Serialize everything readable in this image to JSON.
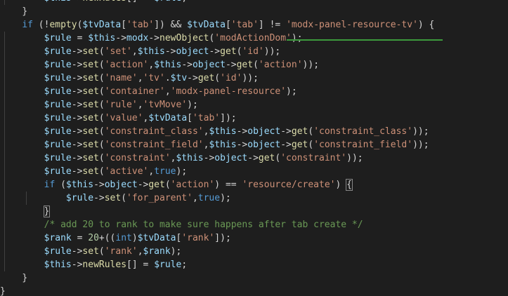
{
  "editor": {
    "theme_colors": {
      "background": "#1e1e1e",
      "keyword": "#569cd6",
      "variable": "#9cdcfe",
      "function": "#dcdcaa",
      "string": "#ce9178",
      "comment": "#6a9955",
      "number": "#b5cea8",
      "plain": "#d4d4d4",
      "squiggle": "#3c9a3c"
    },
    "lines": [
      {
        "indent": 8,
        "tokens": [
          [
            "var",
            "$this"
          ],
          [
            "op",
            "->"
          ],
          [
            "fn",
            "newRules"
          ],
          [
            "op",
            "[] = "
          ],
          [
            "var",
            "$rule"
          ],
          [
            "op",
            ";"
          ]
        ]
      },
      {
        "indent": 4,
        "tokens": [
          [
            "op",
            "}"
          ]
        ]
      },
      {
        "indent": 4,
        "tokens": [
          [
            "kw",
            "if"
          ],
          [
            "op",
            " (!"
          ],
          [
            "fn",
            "empty"
          ],
          [
            "op",
            "("
          ],
          [
            "var",
            "$tvData"
          ],
          [
            "op",
            "["
          ],
          [
            "str",
            "'tab'"
          ],
          [
            "op",
            "]) && "
          ],
          [
            "var",
            "$tvData"
          ],
          [
            "op",
            "["
          ],
          [
            "str",
            "'tab'"
          ],
          [
            "op",
            "] != "
          ],
          [
            "str",
            "'modx-panel-resource-tv'"
          ],
          [
            "op",
            ") {"
          ]
        ]
      },
      {
        "indent": 8,
        "tokens": [
          [
            "var",
            "$rule"
          ],
          [
            "op",
            " = "
          ],
          [
            "var",
            "$this"
          ],
          [
            "op",
            "->"
          ],
          [
            "var",
            "modx"
          ],
          [
            "op",
            "->"
          ],
          [
            "fn",
            "newObject"
          ],
          [
            "op",
            "("
          ],
          [
            "str",
            "'modActionDom'"
          ],
          [
            "op",
            ");"
          ]
        ]
      },
      {
        "indent": 8,
        "tokens": [
          [
            "var",
            "$rule"
          ],
          [
            "op",
            "->"
          ],
          [
            "fn",
            "set"
          ],
          [
            "op",
            "("
          ],
          [
            "str",
            "'set'"
          ],
          [
            "op",
            ","
          ],
          [
            "var",
            "$this"
          ],
          [
            "op",
            "->"
          ],
          [
            "var",
            "object"
          ],
          [
            "op",
            "->"
          ],
          [
            "fn",
            "get"
          ],
          [
            "op",
            "("
          ],
          [
            "str",
            "'id'"
          ],
          [
            "op",
            "));"
          ]
        ]
      },
      {
        "indent": 8,
        "tokens": [
          [
            "var",
            "$rule"
          ],
          [
            "op",
            "->"
          ],
          [
            "fn",
            "set"
          ],
          [
            "op",
            "("
          ],
          [
            "str",
            "'action'"
          ],
          [
            "op",
            ","
          ],
          [
            "var",
            "$this"
          ],
          [
            "op",
            "->"
          ],
          [
            "var",
            "object"
          ],
          [
            "op",
            "->"
          ],
          [
            "fn",
            "get"
          ],
          [
            "op",
            "("
          ],
          [
            "str",
            "'action'"
          ],
          [
            "op",
            "));"
          ]
        ]
      },
      {
        "indent": 8,
        "tokens": [
          [
            "var",
            "$rule"
          ],
          [
            "op",
            "->"
          ],
          [
            "fn",
            "set"
          ],
          [
            "op",
            "("
          ],
          [
            "str",
            "'name'"
          ],
          [
            "op",
            ","
          ],
          [
            "str",
            "'tv'"
          ],
          [
            "op",
            "."
          ],
          [
            "var",
            "$tv"
          ],
          [
            "op",
            "->"
          ],
          [
            "fn",
            "get"
          ],
          [
            "op",
            "("
          ],
          [
            "str",
            "'id'"
          ],
          [
            "op",
            "));"
          ]
        ]
      },
      {
        "indent": 8,
        "tokens": [
          [
            "var",
            "$rule"
          ],
          [
            "op",
            "->"
          ],
          [
            "fn",
            "set"
          ],
          [
            "op",
            "("
          ],
          [
            "str",
            "'container'"
          ],
          [
            "op",
            ","
          ],
          [
            "str",
            "'modx-panel-resource'"
          ],
          [
            "op",
            ");"
          ]
        ]
      },
      {
        "indent": 8,
        "tokens": [
          [
            "var",
            "$rule"
          ],
          [
            "op",
            "->"
          ],
          [
            "fn",
            "set"
          ],
          [
            "op",
            "("
          ],
          [
            "str",
            "'rule'"
          ],
          [
            "op",
            ","
          ],
          [
            "str",
            "'tvMove'"
          ],
          [
            "op",
            ");"
          ]
        ]
      },
      {
        "indent": 8,
        "tokens": [
          [
            "var",
            "$rule"
          ],
          [
            "op",
            "->"
          ],
          [
            "fn",
            "set"
          ],
          [
            "op",
            "("
          ],
          [
            "str",
            "'value'"
          ],
          [
            "op",
            ","
          ],
          [
            "var",
            "$tvData"
          ],
          [
            "op",
            "["
          ],
          [
            "str",
            "'tab'"
          ],
          [
            "op",
            "]);"
          ]
        ]
      },
      {
        "indent": 8,
        "tokens": [
          [
            "var",
            "$rule"
          ],
          [
            "op",
            "->"
          ],
          [
            "fn",
            "set"
          ],
          [
            "op",
            "("
          ],
          [
            "str",
            "'constraint_class'"
          ],
          [
            "op",
            ","
          ],
          [
            "var",
            "$this"
          ],
          [
            "op",
            "->"
          ],
          [
            "var",
            "object"
          ],
          [
            "op",
            "->"
          ],
          [
            "fn",
            "get"
          ],
          [
            "op",
            "("
          ],
          [
            "str",
            "'constraint_class'"
          ],
          [
            "op",
            "));"
          ]
        ]
      },
      {
        "indent": 8,
        "tokens": [
          [
            "var",
            "$rule"
          ],
          [
            "op",
            "->"
          ],
          [
            "fn",
            "set"
          ],
          [
            "op",
            "("
          ],
          [
            "str",
            "'constraint_field'"
          ],
          [
            "op",
            ","
          ],
          [
            "var",
            "$this"
          ],
          [
            "op",
            "->"
          ],
          [
            "var",
            "object"
          ],
          [
            "op",
            "->"
          ],
          [
            "fn",
            "get"
          ],
          [
            "op",
            "("
          ],
          [
            "str",
            "'constraint_field'"
          ],
          [
            "op",
            "));"
          ]
        ]
      },
      {
        "indent": 8,
        "tokens": [
          [
            "var",
            "$rule"
          ],
          [
            "op",
            "->"
          ],
          [
            "fn",
            "set"
          ],
          [
            "op",
            "("
          ],
          [
            "str",
            "'constraint'"
          ],
          [
            "op",
            ","
          ],
          [
            "var",
            "$this"
          ],
          [
            "op",
            "->"
          ],
          [
            "var",
            "object"
          ],
          [
            "op",
            "->"
          ],
          [
            "fn",
            "get"
          ],
          [
            "op",
            "("
          ],
          [
            "str",
            "'constraint'"
          ],
          [
            "op",
            "));"
          ]
        ]
      },
      {
        "indent": 8,
        "tokens": [
          [
            "var",
            "$rule"
          ],
          [
            "op",
            "->"
          ],
          [
            "fn",
            "set"
          ],
          [
            "op",
            "("
          ],
          [
            "str",
            "'active'"
          ],
          [
            "op",
            ","
          ],
          [
            "kw",
            "true"
          ],
          [
            "op",
            ");"
          ]
        ]
      },
      {
        "indent": 8,
        "tokens": [
          [
            "kw",
            "if"
          ],
          [
            "op",
            " ("
          ],
          [
            "var",
            "$this"
          ],
          [
            "op",
            "->"
          ],
          [
            "var",
            "object"
          ],
          [
            "op",
            "->"
          ],
          [
            "fn",
            "get"
          ],
          [
            "op",
            "("
          ],
          [
            "str",
            "'action'"
          ],
          [
            "op",
            ") == "
          ],
          [
            "str",
            "'resource/create'"
          ],
          [
            "op",
            ") "
          ],
          [
            "br",
            "{"
          ]
        ]
      },
      {
        "indent": 12,
        "tokens": [
          [
            "var",
            "$rule"
          ],
          [
            "op",
            "->"
          ],
          [
            "fn",
            "set"
          ],
          [
            "op",
            "("
          ],
          [
            "str",
            "'for_parent'"
          ],
          [
            "op",
            ","
          ],
          [
            "kw",
            "true"
          ],
          [
            "op",
            ");"
          ]
        ]
      },
      {
        "indent": 8,
        "tokens": [
          [
            "br",
            "}"
          ]
        ]
      },
      {
        "indent": 8,
        "tokens": [
          [
            "cm",
            "/* add 20 to rank to make sure happens after tab create */"
          ]
        ]
      },
      {
        "indent": 8,
        "tokens": [
          [
            "var",
            "$rank"
          ],
          [
            "op",
            " = "
          ],
          [
            "num",
            "20"
          ],
          [
            "op",
            "+(("
          ],
          [
            "kw",
            "int"
          ],
          [
            "op",
            ")"
          ],
          [
            "var",
            "$tvData"
          ],
          [
            "op",
            "["
          ],
          [
            "str",
            "'rank'"
          ],
          [
            "op",
            "]);"
          ]
        ]
      },
      {
        "indent": 8,
        "tokens": [
          [
            "var",
            "$rule"
          ],
          [
            "op",
            "->"
          ],
          [
            "fn",
            "set"
          ],
          [
            "op",
            "("
          ],
          [
            "str",
            "'rank'"
          ],
          [
            "op",
            ","
          ],
          [
            "var",
            "$rank"
          ],
          [
            "op",
            ");"
          ]
        ]
      },
      {
        "indent": 8,
        "tokens": [
          [
            "var",
            "$this"
          ],
          [
            "op",
            "->"
          ],
          [
            "fn",
            "newRules"
          ],
          [
            "op",
            "[] = "
          ],
          [
            "var",
            "$rule"
          ],
          [
            "op",
            ";"
          ]
        ]
      },
      {
        "indent": 4,
        "tokens": [
          [
            "op",
            "}"
          ]
        ]
      },
      {
        "indent": 0,
        "tokens": [
          [
            "op",
            "}"
          ]
        ]
      }
    ]
  }
}
